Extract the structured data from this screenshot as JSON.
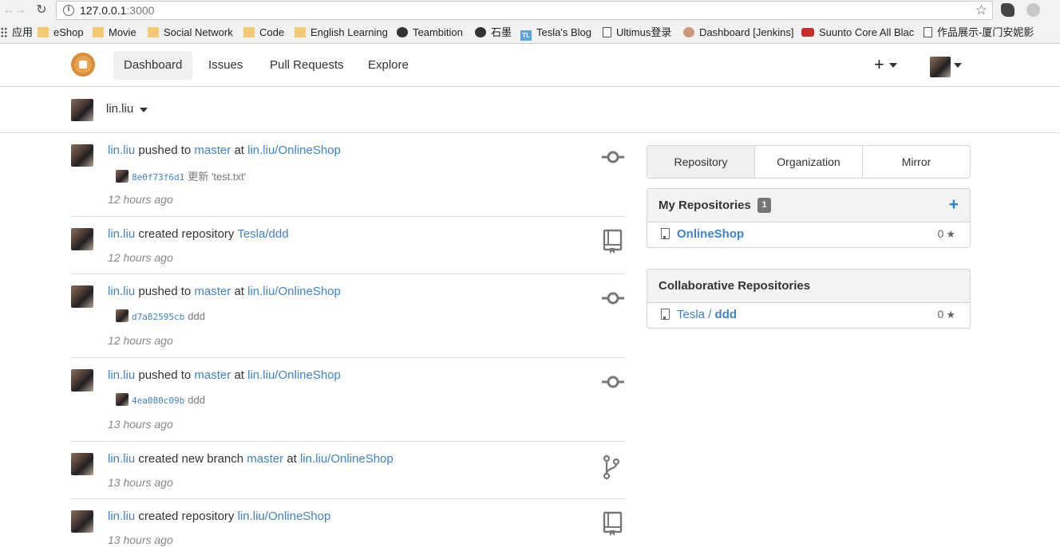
{
  "browser": {
    "url_host": "127.0.0.1",
    "url_port": ":3000",
    "bookmarks": [
      {
        "icon": "apps-grid-icon",
        "label": "应用"
      },
      {
        "icon": "folder-icon",
        "label": "eShop"
      },
      {
        "icon": "folder-icon",
        "label": "Movie"
      },
      {
        "icon": "folder-icon",
        "label": "Social Network"
      },
      {
        "icon": "folder-icon",
        "label": "Code"
      },
      {
        "icon": "folder-icon",
        "label": "English Learning"
      },
      {
        "icon": "teambition-icon",
        "label": "Teambition"
      },
      {
        "icon": "shimo-icon",
        "label": "石墨"
      },
      {
        "icon": "tl-icon",
        "label": "Tesla's Blog"
      },
      {
        "icon": "page-icon",
        "label": "Ultimus登录"
      },
      {
        "icon": "jenkins-icon",
        "label": "Dashboard [Jenkins]"
      },
      {
        "icon": "youtube-icon",
        "label": "Suunto Core All Blac"
      },
      {
        "icon": "page-icon",
        "label": "作品展示-厦门安妮影"
      }
    ]
  },
  "header": {
    "nav": [
      "Dashboard",
      "Issues",
      "Pull Requests",
      "Explore"
    ],
    "plus_label": "+"
  },
  "context": {
    "username": "lin.liu"
  },
  "feed": [
    {
      "user": "lin.liu",
      "action": "pushed to",
      "target": "master",
      "joiner": "at",
      "repo": "lin.liu/OnlineShop",
      "commit_sha": "8e0f73f6d1",
      "commit_msg": "更新 'test.txt'",
      "time": "12 hours ago",
      "icon": "commit-icon"
    },
    {
      "user": "lin.liu",
      "action": "created repository",
      "target": "Tesla/ddd",
      "joiner": "",
      "repo": "",
      "commit_sha": "",
      "commit_msg": "",
      "time": "12 hours ago",
      "icon": "repo-icon"
    },
    {
      "user": "lin.liu",
      "action": "pushed to",
      "target": "master",
      "joiner": "at",
      "repo": "lin.liu/OnlineShop",
      "commit_sha": "d7a82595cb",
      "commit_msg": "ddd",
      "time": "12 hours ago",
      "icon": "commit-icon"
    },
    {
      "user": "lin.liu",
      "action": "pushed to",
      "target": "master",
      "joiner": "at",
      "repo": "lin.liu/OnlineShop",
      "commit_sha": "4ea080c09b",
      "commit_msg": "ddd",
      "time": "13 hours ago",
      "icon": "commit-icon"
    },
    {
      "user": "lin.liu",
      "action": "created new branch",
      "target": "master",
      "joiner": "at",
      "repo": "lin.liu/OnlineShop",
      "commit_sha": "",
      "commit_msg": "",
      "time": "13 hours ago",
      "icon": "branch-icon"
    },
    {
      "user": "lin.liu",
      "action": "created repository",
      "target": "lin.liu/OnlineShop",
      "joiner": "",
      "repo": "",
      "commit_sha": "",
      "commit_msg": "",
      "time": "13 hours ago",
      "icon": "repo-icon"
    }
  ],
  "sidebar": {
    "tabs": [
      "Repository",
      "Organization",
      "Mirror"
    ],
    "my_repos": {
      "title": "My Repositories",
      "count": "1",
      "add_label": "+",
      "items": [
        {
          "owner": "",
          "name": "OnlineShop",
          "stars": "0"
        }
      ]
    },
    "collab_repos": {
      "title": "Collaborative Repositories",
      "items": [
        {
          "owner": "Tesla / ",
          "name": "ddd",
          "stars": "0"
        }
      ]
    }
  },
  "colors": {
    "link": "#4183c4",
    "accent_blue": "#2185d0",
    "logo": "#e8a24b"
  }
}
